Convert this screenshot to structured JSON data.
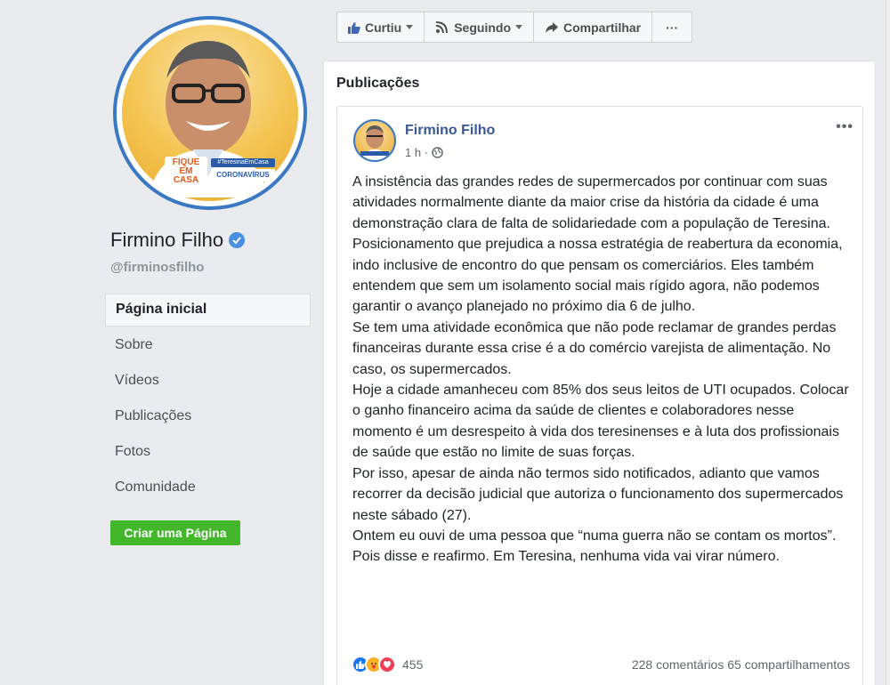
{
  "profile": {
    "name": "Firmino Filho",
    "username": "@firminosfilho",
    "badge_line1": "FIQUE",
    "badge_line2": "EM",
    "badge_line3": "CASA",
    "badge_tag": "#TeresinaEmCasa",
    "badge_corona": "CORONAVÍRUS"
  },
  "nav": {
    "items": [
      {
        "label": "Página inicial",
        "active": true
      },
      {
        "label": "Sobre"
      },
      {
        "label": "Vídeos"
      },
      {
        "label": "Publicações"
      },
      {
        "label": "Fotos"
      },
      {
        "label": "Comunidade"
      }
    ],
    "create_page": "Criar uma Página"
  },
  "actionbar": {
    "like": "Curtiu",
    "follow": "Seguindo",
    "share": "Compartilhar",
    "more": "···"
  },
  "publications": {
    "title": "Publicações",
    "post": {
      "author": "Firmino Filho",
      "time": "1 h ·",
      "more": "•••",
      "paragraphs": [
        "A insistência das grandes redes de supermercados por continuar com suas atividades normalmente diante da maior crise da história da cidade é uma demonstração clara de falta de solidariedade com a população de Teresina.",
        "Posicionamento que prejudica a nossa estratégia de reabertura da economia, indo inclusive de encontro do que pensam os comerciários. Eles também entendem que sem um isolamento social mais rígido agora, não podemos garantir o avanço planejado no próximo dia 6 de julho.",
        "Se tem uma atividade econômica que não pode reclamar de grandes perdas financeiras durante essa crise é a do comércio varejista de alimentação. No caso, os supermercados.",
        "Hoje a cidade amanheceu com 85% dos seus leitos de UTI ocupados. Colocar o ganho financeiro acima da saúde de clientes e colaboradores nesse momento é um desrespeito à vida dos teresinenses e à luta dos profissionais de saúde que estão no limite de suas forças.",
        "Por isso, apesar de ainda não termos sido notificados, adianto que vamos recorrer da decisão judicial que autoriza o funcionamento dos supermercados neste sábado (27).",
        "Ontem eu ouvi de uma pessoa que “numa guerra não se contam os mortos”. Pois disse e reafirmo. Em Teresina, nenhuma vida vai virar número."
      ],
      "reaction_count": "455",
      "comments": "228 comentários",
      "shares": "65 compartilhamentos"
    }
  },
  "colors": {
    "fb_blue": "#385898",
    "green": "#42b72a",
    "ring": "#3b78c4"
  }
}
